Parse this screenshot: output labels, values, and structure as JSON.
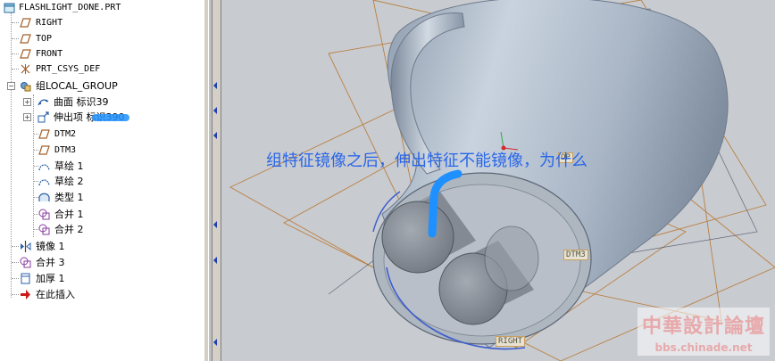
{
  "model_tree": {
    "root_label": "FLASHLIGHT_DONE.PRT",
    "items": [
      {
        "label": "RIGHT",
        "icon": "datum-plane-icon"
      },
      {
        "label": "TOP",
        "icon": "datum-plane-icon"
      },
      {
        "label": "FRONT",
        "icon": "datum-plane-icon"
      },
      {
        "label": "PRT_CSYS_DEF",
        "icon": "coordinate-system-icon"
      },
      {
        "label": "组LOCAL_GROUP",
        "icon": "group-icon"
      },
      {
        "label": "曲面 标识39",
        "icon": "surface-icon"
      },
      {
        "label": "伸出项 标识390",
        "icon": "protrusion-icon"
      },
      {
        "label": "DTM2",
        "icon": "datum-plane-icon"
      },
      {
        "label": "DTM3",
        "icon": "datum-plane-icon"
      },
      {
        "label": "草绘 1",
        "icon": "sketch-icon"
      },
      {
        "label": "草绘 2",
        "icon": "sketch-icon"
      },
      {
        "label": "类型 1",
        "icon": "boundary-blend-icon"
      },
      {
        "label": "合并 1",
        "icon": "merge-icon"
      },
      {
        "label": "合并 2",
        "icon": "merge-icon"
      },
      {
        "label": "镜像 1",
        "icon": "mirror-icon"
      },
      {
        "label": "合并 3",
        "icon": "merge-icon"
      },
      {
        "label": "加厚 1",
        "icon": "thicken-icon"
      },
      {
        "label": "在此插入",
        "icon": "insert-here-arrow-icon"
      }
    ]
  },
  "viewport": {
    "question_text": "组特征镜像之后，伸出特征不能镜像，为什么",
    "datum_labels": {
      "dtm3": "DTM3",
      "right": "RIGHT",
      "top_partial": "OP"
    }
  },
  "watermark": {
    "name": "中華設計論壇",
    "url": "bbs.chinade.net"
  },
  "colors": {
    "question_text": "#2a66e8",
    "scribble": "#1e90ff",
    "model_surface": "#a7b5c6",
    "datum_plane_edge": "#b8742a",
    "viewport_bg": "#c8cbd0",
    "watermark": "#e7a9ab"
  }
}
